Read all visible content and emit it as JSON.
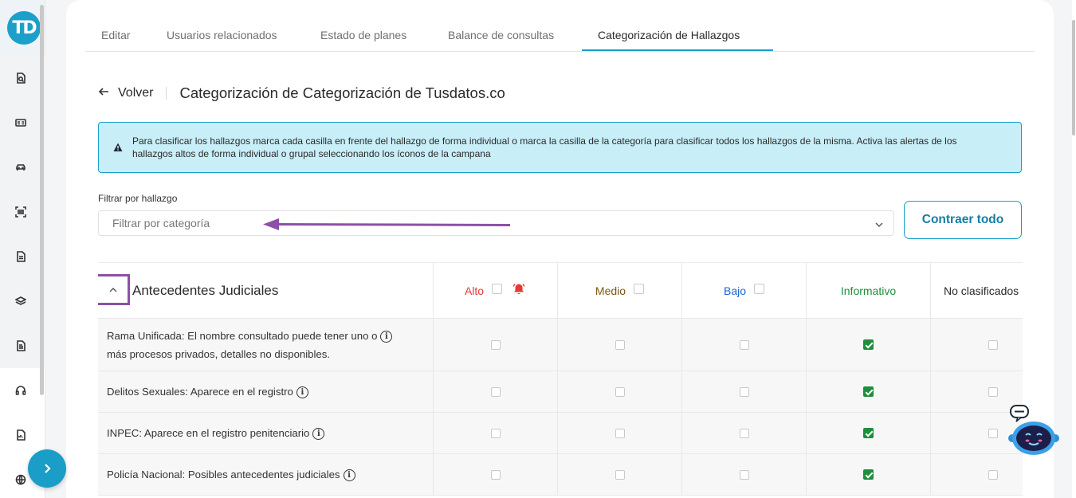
{
  "sidebar": {
    "logo_text": "TD",
    "icons": [
      "document-search-icon",
      "id-card-icon",
      "car-icon",
      "barcode-scan-icon",
      "document-icon",
      "layers-icon",
      "file-text-icon",
      "headset-icon",
      "report-icon",
      "globe-icon"
    ]
  },
  "tabs": [
    {
      "label": "Editar",
      "active": false
    },
    {
      "label": "Usuarios relacionados",
      "active": false
    },
    {
      "label": "Estado de planes",
      "active": false
    },
    {
      "label": "Balance de consultas",
      "active": false
    },
    {
      "label": "Categorización de Hallazgos",
      "active": true
    }
  ],
  "header": {
    "back_label": "Volver",
    "title": "Categorización de Categorización de Tusdatos.co"
  },
  "info_message": "Para clasificar los hallazgos marca cada casilla en frente del hallazgo de forma individual o marca la casilla de la categoría para clasificar todos los hallazgos de la misma. Activa las alertas de los hallazgos altos de forma individual o grupal seleccionando los íconos de la campana",
  "filter": {
    "label": "Filtrar por hallazgo",
    "placeholder": "Filtrar por categoría"
  },
  "collapse_all_label": "Contraer todo",
  "table": {
    "category_title": "Antecedentes Judiciales",
    "levels": [
      {
        "label": "Alto",
        "color": "#e53935"
      },
      {
        "label": "Medio",
        "color": "#7a5a12"
      },
      {
        "label": "Bajo",
        "color": "#1a66cc"
      },
      {
        "label": "Informativo",
        "color": "#1e8f3d"
      },
      {
        "label": "No clasificados",
        "color": "#2a2a2a"
      }
    ],
    "rows": [
      {
        "text_line1": "Rama Unificada: El nombre consultado puede tener uno o",
        "text_line2": "más procesos privados, detalles no disponibles.",
        "checked": "Informativo"
      },
      {
        "text_line1": "Delitos Sexuales: Aparece en el registro",
        "text_line2": "",
        "checked": "Informativo"
      },
      {
        "text_line1": "INPEC: Aparece en el registro penitenciario",
        "text_line2": "",
        "checked": "Informativo"
      },
      {
        "text_line1": "Policía Nacional: Posibles antecedentes judiciales",
        "text_line2": "",
        "checked": "Informativo"
      }
    ]
  },
  "colors": {
    "accent": "#1a9ec8",
    "highlight": "#8e4fa6",
    "checked": "#1e8f3d",
    "info_bg": "#c8eef8"
  }
}
